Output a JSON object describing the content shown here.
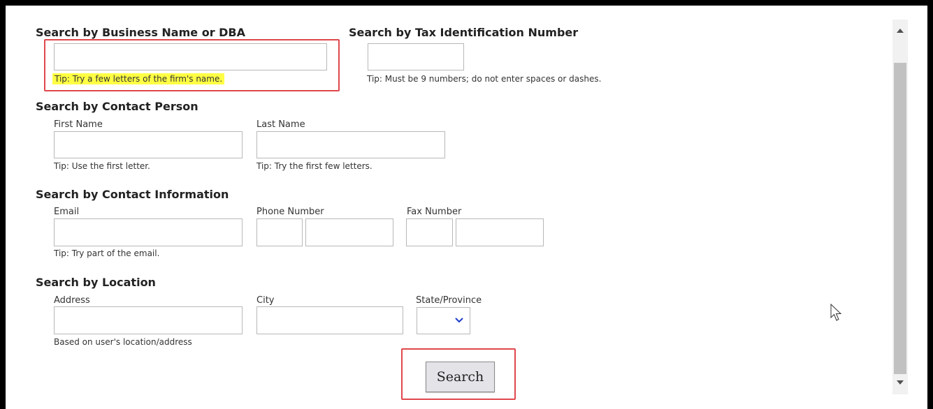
{
  "business": {
    "heading": "Search by Business Name or DBA",
    "tip": "Tip: Try a few letters of the firm's name."
  },
  "tax": {
    "heading": "Search by Tax Identification Number",
    "tip": "Tip: Must be 9 numbers; do not enter spaces or dashes."
  },
  "contact_person": {
    "heading": "Search by Contact Person",
    "first_label": "First Name",
    "first_tip": "Tip: Use the first letter.",
    "last_label": "Last Name",
    "last_tip": "Tip: Try the first few letters."
  },
  "contact_info": {
    "heading": "Search by Contact Information",
    "email_label": "Email",
    "email_tip": "Tip: Try part of the email.",
    "phone_label": "Phone Number",
    "fax_label": "Fax Number"
  },
  "location": {
    "heading": "Search by Location",
    "address_label": "Address",
    "address_tip": "Based on user's location/address",
    "city_label": "City",
    "state_label": "State/Province",
    "state_value": ""
  },
  "search_button": {
    "label": "Search"
  },
  "colors": {
    "highlight": "#ffff44",
    "annotation_red": "#e0474c",
    "select_arrow": "#1a3cc8"
  },
  "icons": {
    "dropdown": "chevron-down-icon",
    "scroll_up": "triangle-up-icon",
    "scroll_down": "triangle-down-icon",
    "cursor": "mouse-pointer-icon"
  }
}
